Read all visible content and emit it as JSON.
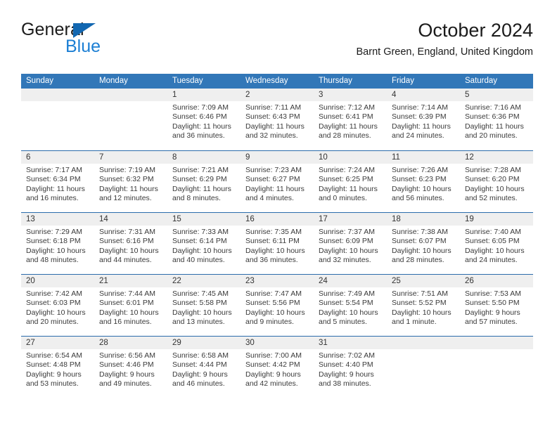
{
  "brand": {
    "name_part1": "General",
    "name_part2": "Blue",
    "triangle_color": "#1267b1",
    "blue_color": "#1c7fd4"
  },
  "header": {
    "title": "October 2024",
    "subtitle": "Barnt Green, England, United Kingdom"
  },
  "theme": {
    "header_row_bg": "#3277b8",
    "row_separator": "#2b6cab",
    "date_band_bg": "#efefef",
    "text_color": "#3a3a3a"
  },
  "weekdays": [
    "Sunday",
    "Monday",
    "Tuesday",
    "Wednesday",
    "Thursday",
    "Friday",
    "Saturday"
  ],
  "weeks": [
    [
      {
        "day": "",
        "empty": true,
        "sunrise": "",
        "sunset": "",
        "daylight1": "",
        "daylight2": ""
      },
      {
        "day": "",
        "empty": true,
        "sunrise": "",
        "sunset": "",
        "daylight1": "",
        "daylight2": ""
      },
      {
        "day": "1",
        "sunrise": "Sunrise: 7:09 AM",
        "sunset": "Sunset: 6:46 PM",
        "daylight1": "Daylight: 11 hours",
        "daylight2": "and 36 minutes."
      },
      {
        "day": "2",
        "sunrise": "Sunrise: 7:11 AM",
        "sunset": "Sunset: 6:43 PM",
        "daylight1": "Daylight: 11 hours",
        "daylight2": "and 32 minutes."
      },
      {
        "day": "3",
        "sunrise": "Sunrise: 7:12 AM",
        "sunset": "Sunset: 6:41 PM",
        "daylight1": "Daylight: 11 hours",
        "daylight2": "and 28 minutes."
      },
      {
        "day": "4",
        "sunrise": "Sunrise: 7:14 AM",
        "sunset": "Sunset: 6:39 PM",
        "daylight1": "Daylight: 11 hours",
        "daylight2": "and 24 minutes."
      },
      {
        "day": "5",
        "sunrise": "Sunrise: 7:16 AM",
        "sunset": "Sunset: 6:36 PM",
        "daylight1": "Daylight: 11 hours",
        "daylight2": "and 20 minutes."
      }
    ],
    [
      {
        "day": "6",
        "sunrise": "Sunrise: 7:17 AM",
        "sunset": "Sunset: 6:34 PM",
        "daylight1": "Daylight: 11 hours",
        "daylight2": "and 16 minutes."
      },
      {
        "day": "7",
        "sunrise": "Sunrise: 7:19 AM",
        "sunset": "Sunset: 6:32 PM",
        "daylight1": "Daylight: 11 hours",
        "daylight2": "and 12 minutes."
      },
      {
        "day": "8",
        "sunrise": "Sunrise: 7:21 AM",
        "sunset": "Sunset: 6:29 PM",
        "daylight1": "Daylight: 11 hours",
        "daylight2": "and 8 minutes."
      },
      {
        "day": "9",
        "sunrise": "Sunrise: 7:23 AM",
        "sunset": "Sunset: 6:27 PM",
        "daylight1": "Daylight: 11 hours",
        "daylight2": "and 4 minutes."
      },
      {
        "day": "10",
        "sunrise": "Sunrise: 7:24 AM",
        "sunset": "Sunset: 6:25 PM",
        "daylight1": "Daylight: 11 hours",
        "daylight2": "and 0 minutes."
      },
      {
        "day": "11",
        "sunrise": "Sunrise: 7:26 AM",
        "sunset": "Sunset: 6:23 PM",
        "daylight1": "Daylight: 10 hours",
        "daylight2": "and 56 minutes."
      },
      {
        "day": "12",
        "sunrise": "Sunrise: 7:28 AM",
        "sunset": "Sunset: 6:20 PM",
        "daylight1": "Daylight: 10 hours",
        "daylight2": "and 52 minutes."
      }
    ],
    [
      {
        "day": "13",
        "sunrise": "Sunrise: 7:29 AM",
        "sunset": "Sunset: 6:18 PM",
        "daylight1": "Daylight: 10 hours",
        "daylight2": "and 48 minutes."
      },
      {
        "day": "14",
        "sunrise": "Sunrise: 7:31 AM",
        "sunset": "Sunset: 6:16 PM",
        "daylight1": "Daylight: 10 hours",
        "daylight2": "and 44 minutes."
      },
      {
        "day": "15",
        "sunrise": "Sunrise: 7:33 AM",
        "sunset": "Sunset: 6:14 PM",
        "daylight1": "Daylight: 10 hours",
        "daylight2": "and 40 minutes."
      },
      {
        "day": "16",
        "sunrise": "Sunrise: 7:35 AM",
        "sunset": "Sunset: 6:11 PM",
        "daylight1": "Daylight: 10 hours",
        "daylight2": "and 36 minutes."
      },
      {
        "day": "17",
        "sunrise": "Sunrise: 7:37 AM",
        "sunset": "Sunset: 6:09 PM",
        "daylight1": "Daylight: 10 hours",
        "daylight2": "and 32 minutes."
      },
      {
        "day": "18",
        "sunrise": "Sunrise: 7:38 AM",
        "sunset": "Sunset: 6:07 PM",
        "daylight1": "Daylight: 10 hours",
        "daylight2": "and 28 minutes."
      },
      {
        "day": "19",
        "sunrise": "Sunrise: 7:40 AM",
        "sunset": "Sunset: 6:05 PM",
        "daylight1": "Daylight: 10 hours",
        "daylight2": "and 24 minutes."
      }
    ],
    [
      {
        "day": "20",
        "sunrise": "Sunrise: 7:42 AM",
        "sunset": "Sunset: 6:03 PM",
        "daylight1": "Daylight: 10 hours",
        "daylight2": "and 20 minutes."
      },
      {
        "day": "21",
        "sunrise": "Sunrise: 7:44 AM",
        "sunset": "Sunset: 6:01 PM",
        "daylight1": "Daylight: 10 hours",
        "daylight2": "and 16 minutes."
      },
      {
        "day": "22",
        "sunrise": "Sunrise: 7:45 AM",
        "sunset": "Sunset: 5:58 PM",
        "daylight1": "Daylight: 10 hours",
        "daylight2": "and 13 minutes."
      },
      {
        "day": "23",
        "sunrise": "Sunrise: 7:47 AM",
        "sunset": "Sunset: 5:56 PM",
        "daylight1": "Daylight: 10 hours",
        "daylight2": "and 9 minutes."
      },
      {
        "day": "24",
        "sunrise": "Sunrise: 7:49 AM",
        "sunset": "Sunset: 5:54 PM",
        "daylight1": "Daylight: 10 hours",
        "daylight2": "and 5 minutes."
      },
      {
        "day": "25",
        "sunrise": "Sunrise: 7:51 AM",
        "sunset": "Sunset: 5:52 PM",
        "daylight1": "Daylight: 10 hours",
        "daylight2": "and 1 minute."
      },
      {
        "day": "26",
        "sunrise": "Sunrise: 7:53 AM",
        "sunset": "Sunset: 5:50 PM",
        "daylight1": "Daylight: 9 hours",
        "daylight2": "and 57 minutes."
      }
    ],
    [
      {
        "day": "27",
        "sunrise": "Sunrise: 6:54 AM",
        "sunset": "Sunset: 4:48 PM",
        "daylight1": "Daylight: 9 hours",
        "daylight2": "and 53 minutes."
      },
      {
        "day": "28",
        "sunrise": "Sunrise: 6:56 AM",
        "sunset": "Sunset: 4:46 PM",
        "daylight1": "Daylight: 9 hours",
        "daylight2": "and 49 minutes."
      },
      {
        "day": "29",
        "sunrise": "Sunrise: 6:58 AM",
        "sunset": "Sunset: 4:44 PM",
        "daylight1": "Daylight: 9 hours",
        "daylight2": "and 46 minutes."
      },
      {
        "day": "30",
        "sunrise": "Sunrise: 7:00 AM",
        "sunset": "Sunset: 4:42 PM",
        "daylight1": "Daylight: 9 hours",
        "daylight2": "and 42 minutes."
      },
      {
        "day": "31",
        "sunrise": "Sunrise: 7:02 AM",
        "sunset": "Sunset: 4:40 PM",
        "daylight1": "Daylight: 9 hours",
        "daylight2": "and 38 minutes."
      },
      {
        "day": "",
        "empty": true,
        "sunrise": "",
        "sunset": "",
        "daylight1": "",
        "daylight2": ""
      },
      {
        "day": "",
        "empty": true,
        "sunrise": "",
        "sunset": "",
        "daylight1": "",
        "daylight2": ""
      }
    ]
  ]
}
